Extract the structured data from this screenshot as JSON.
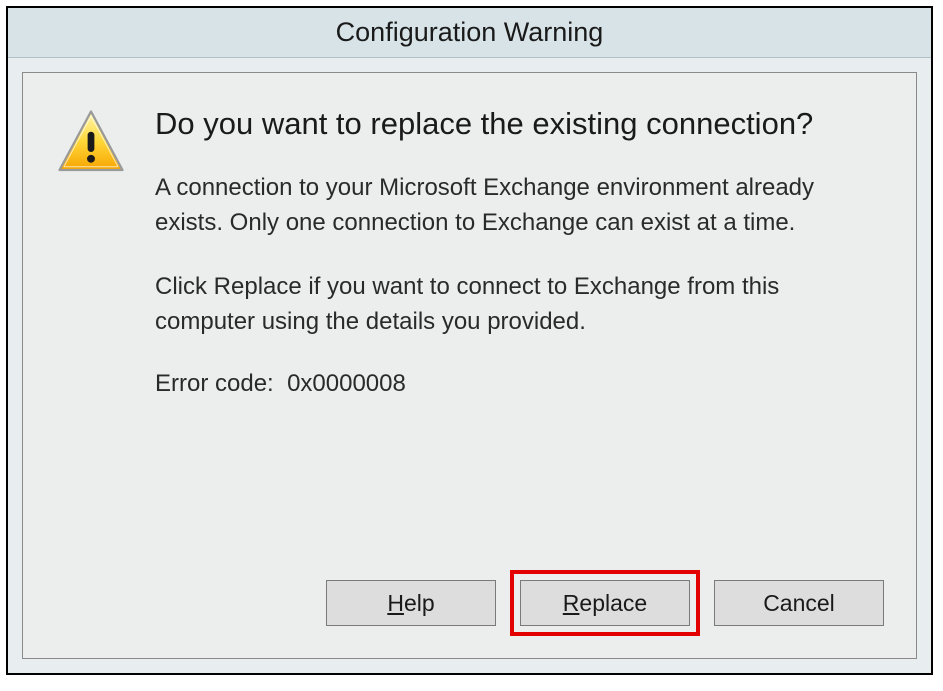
{
  "dialog": {
    "title": "Configuration Warning",
    "main_question": "Do you want to replace the existing connection?",
    "paragraph1": "A connection to your Microsoft Exchange environment already exists. Only one connection to Exchange can exist at a time.",
    "paragraph2": "Click Replace if you want to connect to Exchange from this computer using the details you provided.",
    "error_label": "Error code:",
    "error_code": "0x0000008",
    "buttons": {
      "help": "Help",
      "replace": "Replace",
      "cancel": "Cancel"
    },
    "icon": "warning-icon"
  }
}
